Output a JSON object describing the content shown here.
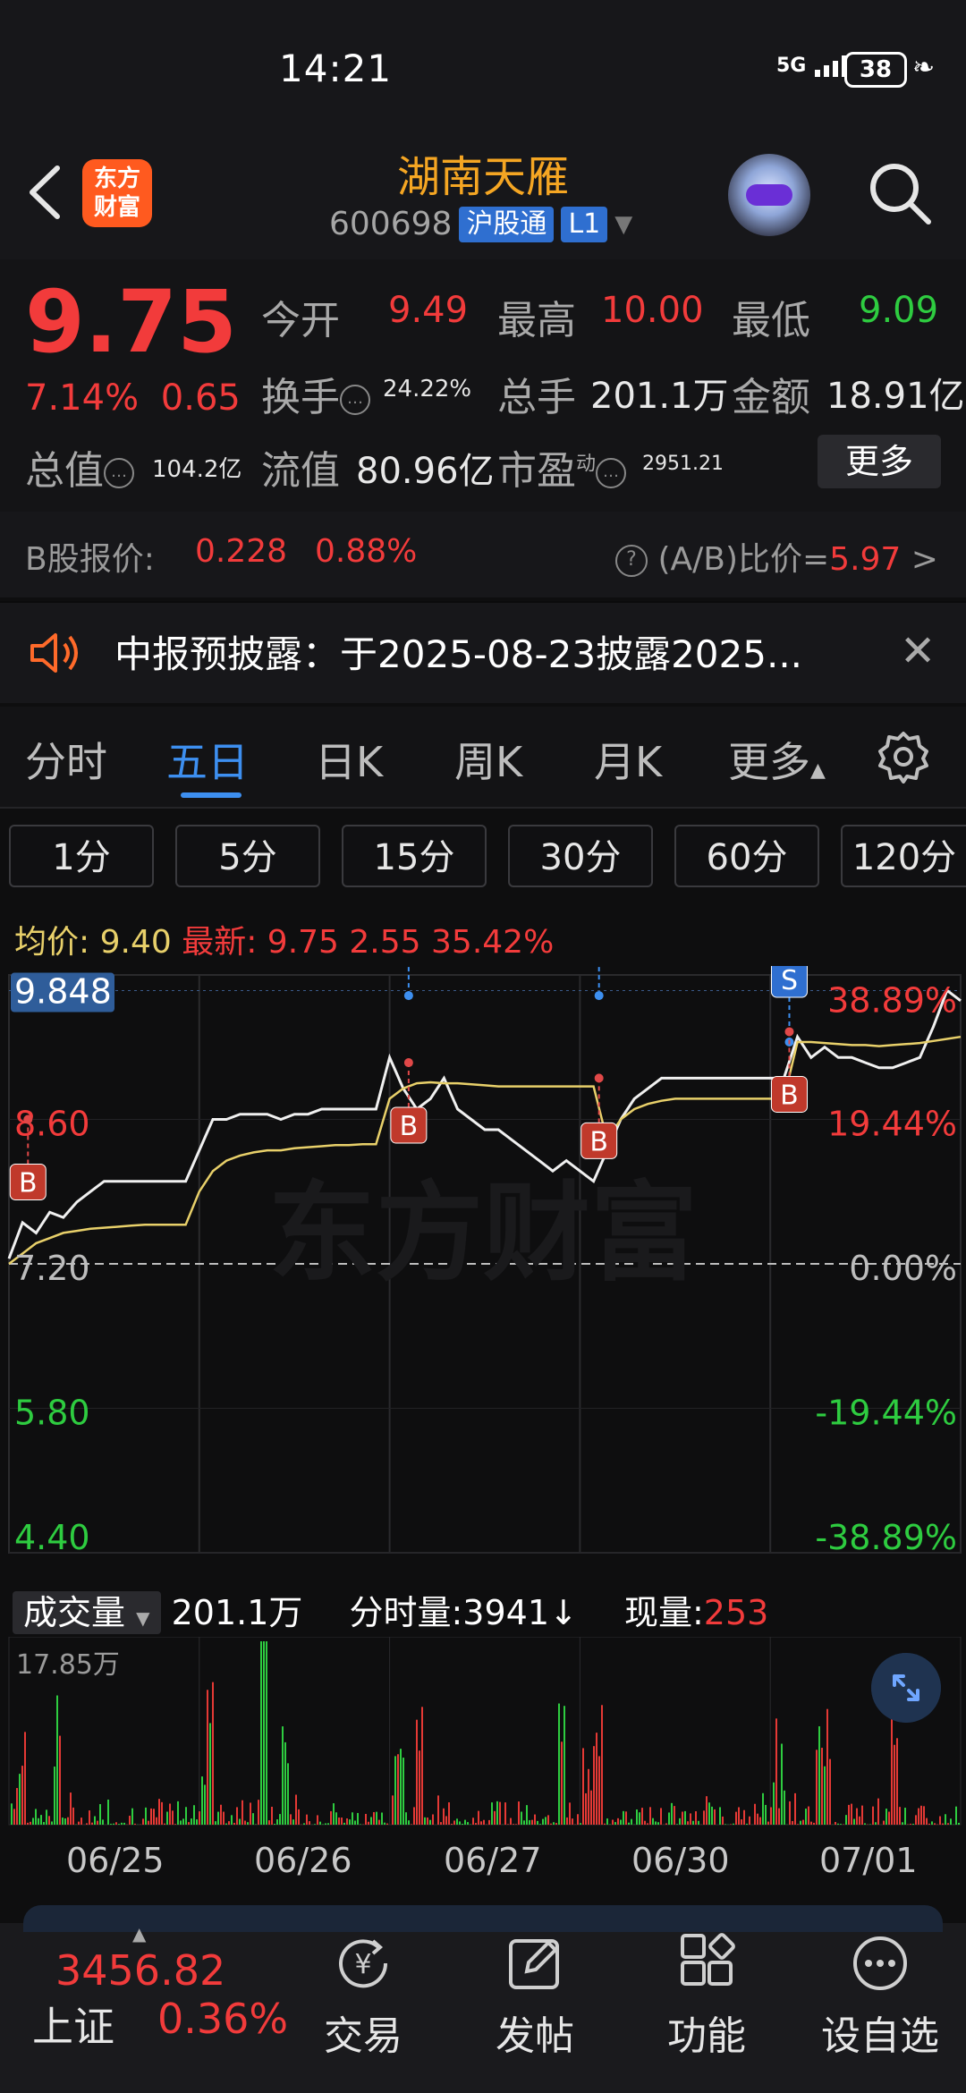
{
  "status_bar": {
    "time": "14:21",
    "signal": "5G",
    "battery": "38"
  },
  "header": {
    "logo_line1": "东方",
    "logo_line2": "财富",
    "stock_name": "湖南天雁",
    "stock_code": "600698",
    "connect_tag": "沪股通",
    "level_tag": "L1"
  },
  "quote": {
    "price": "9.75",
    "change_pct": "7.14%",
    "change_amt": "0.65",
    "open_label": "今开",
    "open_value": "9.49",
    "high_label": "最高",
    "high_value": "10.00",
    "low_label": "最低",
    "low_value": "9.09",
    "turnover_label": "换手",
    "turnover_value": "24.22%",
    "volume_label": "总手",
    "volume_value": "201.1万",
    "amount_label": "金额",
    "amount_value": "18.91亿",
    "mktcap_label": "总值",
    "mktcap_value": "104.2亿",
    "float_label": "流值",
    "float_value": "80.96亿",
    "pe_label": "市盈",
    "pe_sup": "动",
    "pe_value": "2951.21",
    "more_button": "更多"
  },
  "b_share": {
    "label": "B股报价:",
    "price": "0.228",
    "pct": "0.88%",
    "ratio_label": "(A/B)比价=",
    "ratio_value": "5.97",
    "arrow": ">"
  },
  "notice": {
    "text": "中报预披露：于2025-08-23披露2025..."
  },
  "tabs": [
    "分时",
    "五日",
    "日K",
    "周K",
    "月K",
    "更多"
  ],
  "active_tab": "五日",
  "periods": [
    "1分",
    "5分",
    "15分",
    "30分",
    "60分",
    "120分"
  ],
  "avg_row": {
    "avg_label": "均价:",
    "avg_value": "9.40",
    "latest_label": "最新:",
    "latest_value": "9.75",
    "latest_change": "2.55",
    "latest_pct": "35.42%"
  },
  "chart_data": {
    "type": "line",
    "title": "",
    "x": [
      "06/25",
      "06/26",
      "06/27",
      "06/30",
      "07/01"
    ],
    "ylim": [
      4.4,
      10.0
    ],
    "y_ticks_left": [
      "9.848",
      "8.60",
      "7.20",
      "5.80",
      "4.40"
    ],
    "y_ticks_right": [
      "38.89%",
      "19.44%",
      "0.00%",
      "-19.44%",
      "-38.89%"
    ],
    "baseline": 7.2,
    "series": [
      {
        "name": "",
        "color": "#f0f0f0",
        "values": [
          7.25,
          7.6,
          7.5,
          7.7,
          7.65,
          7.8,
          7.9,
          8.0,
          8.0,
          8.0,
          8.0,
          8.0,
          8.0,
          8.0,
          8.3,
          8.6,
          8.6,
          8.65,
          8.65,
          8.65,
          8.6,
          8.65,
          8.65,
          8.7,
          8.7,
          8.7,
          8.7,
          8.7,
          9.2,
          8.9,
          8.7,
          8.8,
          9.0,
          8.7,
          8.6,
          8.5,
          8.5,
          8.4,
          8.3,
          8.2,
          8.1,
          8.2,
          8.1,
          8.0,
          8.3,
          8.6,
          8.8,
          8.9,
          9.0,
          9.0,
          9.0,
          9.0,
          9.0,
          9.0,
          9.0,
          9.0,
          9.0,
          9.0,
          9.4,
          9.2,
          9.3,
          9.2,
          9.2,
          9.15,
          9.1,
          9.1,
          9.15,
          9.2,
          9.5,
          9.85,
          9.75
        ]
      },
      {
        "name": "均价",
        "color": "#e8d06a",
        "values": [
          7.2,
          7.3,
          7.4,
          7.45,
          7.5,
          7.52,
          7.54,
          7.55,
          7.56,
          7.57,
          7.58,
          7.58,
          7.58,
          7.58,
          7.9,
          8.1,
          8.2,
          8.25,
          8.28,
          8.3,
          8.3,
          8.32,
          8.33,
          8.34,
          8.35,
          8.35,
          8.36,
          8.36,
          8.8,
          8.9,
          8.95,
          8.96,
          8.95,
          8.95,
          8.94,
          8.93,
          8.92,
          8.92,
          8.92,
          8.92,
          8.92,
          8.92,
          8.92,
          8.92,
          8.4,
          8.6,
          8.7,
          8.75,
          8.78,
          8.8,
          8.8,
          8.8,
          8.8,
          8.8,
          8.8,
          8.8,
          8.8,
          8.8,
          9.35,
          9.35,
          9.34,
          9.33,
          9.32,
          9.32,
          9.31,
          9.32,
          9.33,
          9.34,
          9.36,
          9.38,
          9.4
        ]
      }
    ],
    "signals": [
      {
        "type": "B",
        "day": 0,
        "price": 8.6
      },
      {
        "type": "S",
        "day": 2,
        "price": 9.8
      },
      {
        "type": "B",
        "day": 2,
        "price": 9.15
      },
      {
        "type": "S",
        "day": 3,
        "price": 9.8
      },
      {
        "type": "B",
        "day": 3,
        "price": 9.0
      },
      {
        "type": "S",
        "day": 4,
        "price": 9.35
      },
      {
        "type": "B",
        "day": 4,
        "price": 9.45
      }
    ]
  },
  "volume": {
    "label": "成交量",
    "total": "201.1万",
    "minute_label": "分时量:",
    "minute_value": "3941",
    "minute_arrow": "↓",
    "now_label": "现量:",
    "now_value": "253",
    "max_label": "17.85万"
  },
  "watermark": "东方财富",
  "bottom_nav": {
    "index_value": "3456.82",
    "index_name": "上证",
    "index_pct": "0.36%",
    "items": [
      "交易",
      "发帖",
      "功能",
      "设自选"
    ]
  },
  "colors": {
    "up": "#f23b3b",
    "down": "#2ecc40",
    "accent": "#3d8ff0",
    "avg": "#e8d06a"
  }
}
